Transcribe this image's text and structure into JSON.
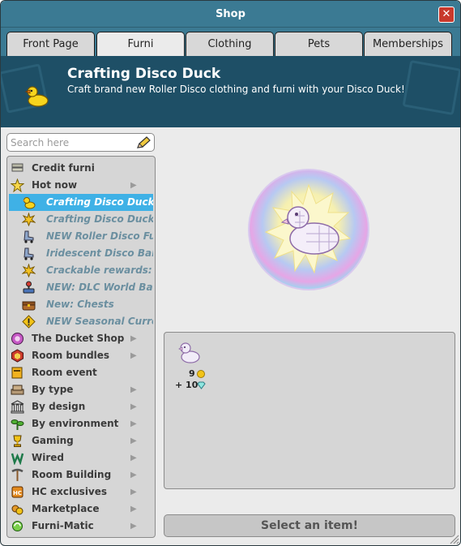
{
  "window": {
    "title": "Shop",
    "close_icon": "close-icon"
  },
  "tabs": [
    {
      "label": "Front Page",
      "active": false
    },
    {
      "label": "Furni",
      "active": true
    },
    {
      "label": "Clothing",
      "active": false
    },
    {
      "label": "Pets",
      "active": false
    },
    {
      "label": "Memberships",
      "active": false
    }
  ],
  "banner": {
    "title": "Crafting Disco Duck",
    "subtitle": "Craft brand new Roller Disco clothing and furni with your Disco Duck!",
    "icon": "duck-icon"
  },
  "search": {
    "placeholder": "Search here",
    "value": "",
    "icon": "pencil-icon"
  },
  "categories": [
    {
      "label": "Credit furni",
      "icon": "credit-furni-icon",
      "sub": false,
      "arrow": false,
      "selected": false
    },
    {
      "label": "Hot now",
      "icon": "star-icon",
      "sub": false,
      "arrow": true,
      "selected": false
    },
    {
      "label": "Crafting Disco Duck",
      "icon": "duck-icon",
      "sub": true,
      "arrow": false,
      "selected": true
    },
    {
      "label": "Crafting Disco Duck",
      "icon": "sparkle-icon",
      "sub": true,
      "arrow": false,
      "selected": false
    },
    {
      "label": "NEW Roller Disco Furni:",
      "icon": "roller-skate-icon",
      "sub": true,
      "arrow": false,
      "selected": false
    },
    {
      "label": "Iridescent Disco Ball",
      "icon": "roller-skate-icon",
      "sub": true,
      "arrow": false,
      "selected": false
    },
    {
      "label": "Crackable rewards: Prol",
      "icon": "sparkle-icon",
      "sub": true,
      "arrow": false,
      "selected": false
    },
    {
      "label": "NEW: DLC World Badge",
      "icon": "joystick-icon",
      "sub": true,
      "arrow": false,
      "selected": false
    },
    {
      "label": "New: Chests",
      "icon": "chest-icon",
      "sub": true,
      "arrow": false,
      "selected": false
    },
    {
      "label": "NEW Seasonal Currency",
      "icon": "warning-icon",
      "sub": true,
      "arrow": false,
      "selected": false
    },
    {
      "label": "The Ducket Shop",
      "icon": "ducket-icon",
      "sub": false,
      "arrow": true,
      "selected": false
    },
    {
      "label": "Room bundles",
      "icon": "bundle-icon",
      "sub": false,
      "arrow": true,
      "selected": false
    },
    {
      "label": "Room event",
      "icon": "event-icon",
      "sub": false,
      "arrow": false,
      "selected": false
    },
    {
      "label": "By type",
      "icon": "sofa-icon",
      "sub": false,
      "arrow": true,
      "selected": false
    },
    {
      "label": "By design",
      "icon": "columns-icon",
      "sub": false,
      "arrow": true,
      "selected": false
    },
    {
      "label": "By environment",
      "icon": "plant-icon",
      "sub": false,
      "arrow": true,
      "selected": false
    },
    {
      "label": "Gaming",
      "icon": "trophy-icon",
      "sub": false,
      "arrow": true,
      "selected": false
    },
    {
      "label": "Wired",
      "icon": "wired-icon",
      "sub": false,
      "arrow": true,
      "selected": false
    },
    {
      "label": "Room Building",
      "icon": "pickaxe-icon",
      "sub": false,
      "arrow": true,
      "selected": false
    },
    {
      "label": "HC exclusives",
      "icon": "hc-icon",
      "sub": false,
      "arrow": true,
      "selected": false
    },
    {
      "label": "Marketplace",
      "icon": "marketplace-icon",
      "sub": false,
      "arrow": true,
      "selected": false
    },
    {
      "label": "Furni-Matic",
      "icon": "recycle-icon",
      "sub": false,
      "arrow": true,
      "selected": false
    }
  ],
  "preview": {
    "icon": "disco-duck-icon"
  },
  "item": {
    "icon": "duck-icon",
    "price_credits": "9",
    "price_diamonds": "+ 10",
    "credit_icon": "coin-icon",
    "diamond_icon": "diamond-icon"
  },
  "select_button": {
    "label": "Select an item!"
  },
  "colors": {
    "titlebar": "#3b7a93",
    "banner": "#1e4f66",
    "selected": "#3fb1e6",
    "close": "#c8392c"
  }
}
